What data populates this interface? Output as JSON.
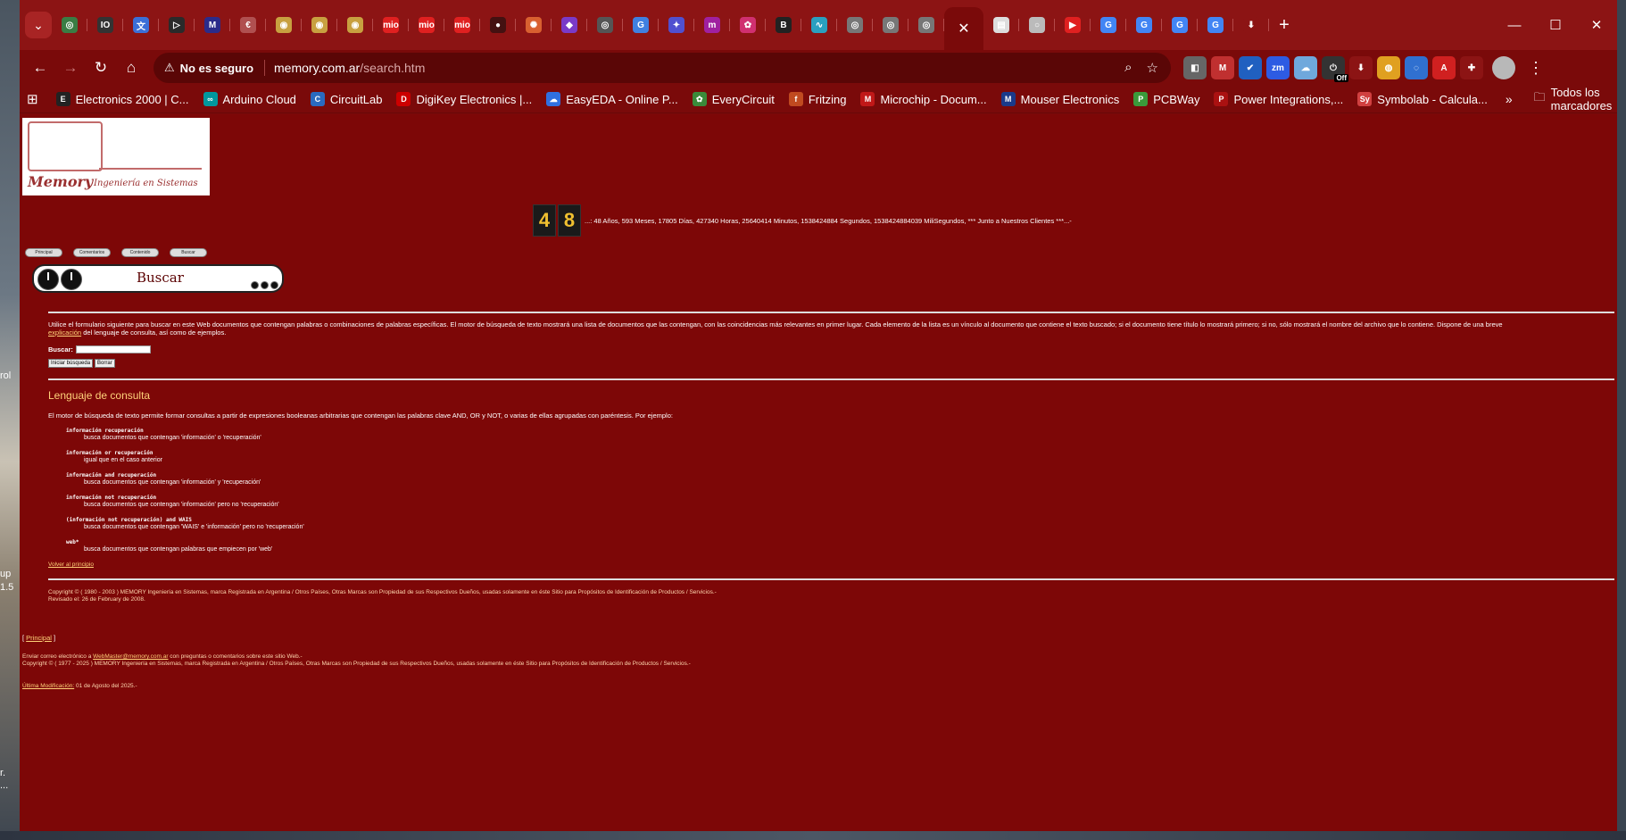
{
  "desktop": {
    "labels": [
      "rol",
      "up",
      "1.5",
      "r.",
      "..."
    ]
  },
  "browser": {
    "url_warning": "No es seguro",
    "url_host": "memory.com.ar",
    "url_path": "/search.htm",
    "tabs": [
      {
        "icon": "tab-icon-1",
        "color": "#3a7d44",
        "glyph": "◎"
      },
      {
        "icon": "tab-icon-2",
        "color": "#333333",
        "glyph": "IO"
      },
      {
        "icon": "tab-icon-3",
        "color": "#3b6fd8",
        "glyph": "文"
      },
      {
        "icon": "tab-icon-4",
        "color": "#2a2a2a",
        "glyph": "▷"
      },
      {
        "icon": "tab-icon-5",
        "color": "#2b2b8a",
        "glyph": "M"
      },
      {
        "icon": "tab-icon-6",
        "color": "#b05050",
        "glyph": "€"
      },
      {
        "icon": "tab-icon-7",
        "color": "#c8a040",
        "glyph": "◉"
      },
      {
        "icon": "tab-icon-8",
        "color": "#c8a040",
        "glyph": "◉"
      },
      {
        "icon": "tab-icon-9",
        "color": "#c8a040",
        "glyph": "◉"
      },
      {
        "icon": "tab-icon-10",
        "color": "#e02020",
        "glyph": "mio"
      },
      {
        "icon": "tab-icon-11",
        "color": "#e02020",
        "glyph": "mio"
      },
      {
        "icon": "tab-icon-12",
        "color": "#e02020",
        "glyph": "mio"
      },
      {
        "icon": "tab-icon-13",
        "color": "#441111",
        "glyph": "●"
      },
      {
        "icon": "tab-icon-14",
        "color": "#d86030",
        "glyph": "✺"
      },
      {
        "icon": "tab-icon-15",
        "color": "#7a3ac8",
        "glyph": "◆"
      },
      {
        "icon": "tab-icon-16",
        "color": "#555555",
        "glyph": "◎"
      },
      {
        "icon": "tab-icon-17",
        "color": "#4080e0",
        "glyph": "G"
      },
      {
        "icon": "tab-icon-18",
        "color": "#5050d0",
        "glyph": "✦"
      },
      {
        "icon": "tab-icon-19",
        "color": "#a020a0",
        "glyph": "m"
      },
      {
        "icon": "tab-icon-20",
        "color": "#d03070",
        "glyph": "✿"
      },
      {
        "icon": "tab-icon-21",
        "color": "#222222",
        "glyph": "B"
      },
      {
        "icon": "tab-icon-22",
        "color": "#2aa0c0",
        "glyph": "∿"
      },
      {
        "icon": "tab-icon-23",
        "color": "#777777",
        "glyph": "◎"
      },
      {
        "icon": "tab-icon-24",
        "color": "#777777",
        "glyph": "◎"
      },
      {
        "icon": "tab-icon-25",
        "color": "#777777",
        "glyph": "◎"
      }
    ],
    "tabs_after": [
      {
        "icon": "tab-icon-doc",
        "color": "#dddddd",
        "glyph": "▤"
      },
      {
        "icon": "tab-icon-circle",
        "color": "#bbbbbb",
        "glyph": "○"
      },
      {
        "icon": "tab-icon-youtube",
        "color": "#e02020",
        "glyph": "▶"
      },
      {
        "icon": "tab-icon-google-1",
        "color": "#4285f4",
        "glyph": "G"
      },
      {
        "icon": "tab-icon-google-2",
        "color": "#4285f4",
        "glyph": "G"
      },
      {
        "icon": "tab-icon-google-3",
        "color": "#4285f4",
        "glyph": "G"
      },
      {
        "icon": "tab-icon-google-4",
        "color": "#4285f4",
        "glyph": "G"
      },
      {
        "icon": "tab-icon-download",
        "color": "#8c1414",
        "glyph": "⬇"
      }
    ],
    "extensions": [
      {
        "name": "ext-icon-1",
        "color": "#666666",
        "glyph": "◧"
      },
      {
        "name": "ext-icon-2",
        "color": "#c03030",
        "glyph": "M"
      },
      {
        "name": "ext-icon-3",
        "color": "#2060c0",
        "glyph": "✔"
      },
      {
        "name": "ext-icon-4",
        "color": "#2d5be3",
        "glyph": "zm"
      },
      {
        "name": "ext-icon-5",
        "color": "#6fa8dc",
        "glyph": "☁"
      },
      {
        "name": "ext-icon-6",
        "color": "#333333",
        "glyph": "⏻",
        "badge": "Off"
      },
      {
        "name": "ext-icon-7",
        "color": "#8c1414",
        "glyph": "⬇"
      },
      {
        "name": "ext-icon-8",
        "color": "#e0a020",
        "glyph": "◍"
      },
      {
        "name": "ext-icon-9",
        "color": "#3070d0",
        "glyph": "◌"
      },
      {
        "name": "ext-icon-10",
        "color": "#d02020",
        "glyph": "A"
      },
      {
        "name": "ext-icon-11",
        "color": "#8c1414",
        "glyph": "✚"
      }
    ],
    "bookmarks": [
      {
        "label": "Electronics 2000 | C...",
        "color": "#222222",
        "glyph": "E"
      },
      {
        "label": "Arduino Cloud",
        "color": "#00979d",
        "glyph": "∞"
      },
      {
        "label": "CircuitLab",
        "color": "#2a6ac0",
        "glyph": "C"
      },
      {
        "label": "DigiKey Electronics |...",
        "color": "#cc0000",
        "glyph": "D"
      },
      {
        "label": "EasyEDA - Online P...",
        "color": "#3070e0",
        "glyph": "☁"
      },
      {
        "label": "EveryCircuit",
        "color": "#3a8a3a",
        "glyph": "✿"
      },
      {
        "label": "Fritzing",
        "color": "#c04a20",
        "glyph": "f"
      },
      {
        "label": "Microchip - Docum...",
        "color": "#c01818",
        "glyph": "M"
      },
      {
        "label": "Mouser Electronics",
        "color": "#1a3a8a",
        "glyph": "M"
      },
      {
        "label": "PCBWay",
        "color": "#3a9a3a",
        "glyph": "P"
      },
      {
        "label": "Power Integrations,...",
        "color": "#aa1111",
        "glyph": "P"
      },
      {
        "label": "Symbolab - Calcula...",
        "color": "#d04040",
        "glyph": "Sy"
      }
    ],
    "bookmarks_more": "»",
    "all_bookmarks": "Todos los marcadores"
  },
  "page": {
    "logo_brand": "Memory",
    "logo_tagline": "Ingeniería en Sistemas",
    "counter_digits": [
      "4",
      "8"
    ],
    "counter_text": "...: 48 Años, 593 Meses, 17805 Días, 427340 Horas, 25640414 Minutos, 1538424884 Segundos, 1538424884039 MiliSegundos, *** Junto a Nuestros Clientes ***...-",
    "nav_buttons": [
      "Principal",
      "Comentarios",
      "Contenido",
      "Buscar"
    ],
    "banner_title": "Buscar",
    "intro_text": "Utilice el formulario siguiente para buscar en este Web documentos que contengan palabras o combinaciones de palabras específicas. El motor de búsqueda de texto mostrará una lista de documentos que las contengan, con las coincidencias más relevantes en primer lugar. Cada elemento de la lista es un vínculo al documento que contiene el texto buscado; si el documento tiene título lo mostrará primero; si no, sólo mostrará el nombre del archivo que lo contiene. Dispone de una breve",
    "intro_link": "explicación",
    "intro_tail": " del lenguaje de consulta, así como de ejemplos.",
    "search_label": "Buscar:",
    "search_value": "",
    "btn_search": "Iniciar búsqueda",
    "btn_clear": "Borrar",
    "section_title": "Lenguaje de consulta",
    "section_intro": "El motor de búsqueda de texto permite formar consultas a partir de expresiones booleanas arbitrarias que contengan las palabras clave AND, OR y NOT, o varias de ellas agrupadas con paréntesis. Por ejemplo:",
    "examples": [
      {
        "q": "información recuperación",
        "d": "busca documentos que contengan 'información' o 'recuperación'"
      },
      {
        "q": "información or recuperación",
        "d": "igual que en el caso anterior"
      },
      {
        "q": "información and recuperación",
        "d": "busca documentos que contengan 'información' y 'recuperación'"
      },
      {
        "q": "información not recuperación",
        "d": "busca documentos que contengan 'información' pero no 'recuperación'"
      },
      {
        "q": "(información not recuperación) and WAIS",
        "d": "busca documentos que contengan 'WAIS' e 'información' pero no 'recuperación'"
      },
      {
        "q": "web*",
        "d": "busca documentos que contengan palabras que empiecen por 'web'"
      }
    ],
    "back_link": "Volver al principio",
    "copyright1": "Copyright © ( 1980 - 2003 ) MEMORY Ingeniería en Sistemas, marca Registrada en Argentina / Otros Países, Otras Marcas son Propiedad de sus Respectivos Dueños, usadas solamente en éste Sitio para Propósitos de Identificación de Productos / Servicios.-",
    "revised": "Revisado el: 26 de February de 2008.",
    "footer_open": "[ ",
    "footer_link": "Principal",
    "footer_close": " ]",
    "email_prefix": "Enviar correo electrónico a ",
    "email_link": "WebMaster@memory.com.ar",
    "email_suffix": " con preguntas o comentarios sobre este sitio Web.-",
    "copyright2": "Copyright © ( 1977 - 2025 ) MEMORY Ingeniería en Sistemas, marca Registrada en Argentina / Otros Países, Otras Marcas son Propiedad de sus Respectivos Dueños, usadas solamente en éste Sitio para Propósitos de Identificación de Productos / Servicios.-",
    "last_mod_link": "Última Modificación:",
    "last_mod_date": " 01 de Agosto del 2025.-"
  }
}
